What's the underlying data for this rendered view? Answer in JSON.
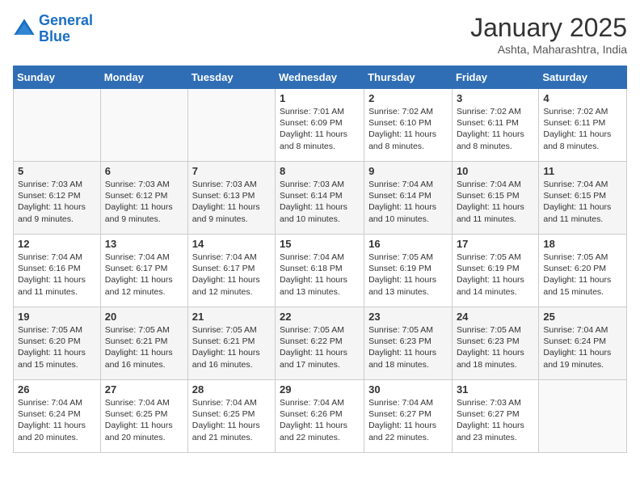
{
  "header": {
    "logo_line1": "General",
    "logo_line2": "Blue",
    "month": "January 2025",
    "location": "Ashta, Maharashtra, India"
  },
  "weekdays": [
    "Sunday",
    "Monday",
    "Tuesday",
    "Wednesday",
    "Thursday",
    "Friday",
    "Saturday"
  ],
  "weeks": [
    [
      {
        "day": "",
        "info": ""
      },
      {
        "day": "",
        "info": ""
      },
      {
        "day": "",
        "info": ""
      },
      {
        "day": "1",
        "info": "Sunrise: 7:01 AM\nSunset: 6:09 PM\nDaylight: 11 hours and 8 minutes."
      },
      {
        "day": "2",
        "info": "Sunrise: 7:02 AM\nSunset: 6:10 PM\nDaylight: 11 hours and 8 minutes."
      },
      {
        "day": "3",
        "info": "Sunrise: 7:02 AM\nSunset: 6:11 PM\nDaylight: 11 hours and 8 minutes."
      },
      {
        "day": "4",
        "info": "Sunrise: 7:02 AM\nSunset: 6:11 PM\nDaylight: 11 hours and 8 minutes."
      }
    ],
    [
      {
        "day": "5",
        "info": "Sunrise: 7:03 AM\nSunset: 6:12 PM\nDaylight: 11 hours and 9 minutes."
      },
      {
        "day": "6",
        "info": "Sunrise: 7:03 AM\nSunset: 6:12 PM\nDaylight: 11 hours and 9 minutes."
      },
      {
        "day": "7",
        "info": "Sunrise: 7:03 AM\nSunset: 6:13 PM\nDaylight: 11 hours and 9 minutes."
      },
      {
        "day": "8",
        "info": "Sunrise: 7:03 AM\nSunset: 6:14 PM\nDaylight: 11 hours and 10 minutes."
      },
      {
        "day": "9",
        "info": "Sunrise: 7:04 AM\nSunset: 6:14 PM\nDaylight: 11 hours and 10 minutes."
      },
      {
        "day": "10",
        "info": "Sunrise: 7:04 AM\nSunset: 6:15 PM\nDaylight: 11 hours and 11 minutes."
      },
      {
        "day": "11",
        "info": "Sunrise: 7:04 AM\nSunset: 6:15 PM\nDaylight: 11 hours and 11 minutes."
      }
    ],
    [
      {
        "day": "12",
        "info": "Sunrise: 7:04 AM\nSunset: 6:16 PM\nDaylight: 11 hours and 11 minutes."
      },
      {
        "day": "13",
        "info": "Sunrise: 7:04 AM\nSunset: 6:17 PM\nDaylight: 11 hours and 12 minutes."
      },
      {
        "day": "14",
        "info": "Sunrise: 7:04 AM\nSunset: 6:17 PM\nDaylight: 11 hours and 12 minutes."
      },
      {
        "day": "15",
        "info": "Sunrise: 7:04 AM\nSunset: 6:18 PM\nDaylight: 11 hours and 13 minutes."
      },
      {
        "day": "16",
        "info": "Sunrise: 7:05 AM\nSunset: 6:19 PM\nDaylight: 11 hours and 13 minutes."
      },
      {
        "day": "17",
        "info": "Sunrise: 7:05 AM\nSunset: 6:19 PM\nDaylight: 11 hours and 14 minutes."
      },
      {
        "day": "18",
        "info": "Sunrise: 7:05 AM\nSunset: 6:20 PM\nDaylight: 11 hours and 15 minutes."
      }
    ],
    [
      {
        "day": "19",
        "info": "Sunrise: 7:05 AM\nSunset: 6:20 PM\nDaylight: 11 hours and 15 minutes."
      },
      {
        "day": "20",
        "info": "Sunrise: 7:05 AM\nSunset: 6:21 PM\nDaylight: 11 hours and 16 minutes."
      },
      {
        "day": "21",
        "info": "Sunrise: 7:05 AM\nSunset: 6:21 PM\nDaylight: 11 hours and 16 minutes."
      },
      {
        "day": "22",
        "info": "Sunrise: 7:05 AM\nSunset: 6:22 PM\nDaylight: 11 hours and 17 minutes."
      },
      {
        "day": "23",
        "info": "Sunrise: 7:05 AM\nSunset: 6:23 PM\nDaylight: 11 hours and 18 minutes."
      },
      {
        "day": "24",
        "info": "Sunrise: 7:05 AM\nSunset: 6:23 PM\nDaylight: 11 hours and 18 minutes."
      },
      {
        "day": "25",
        "info": "Sunrise: 7:04 AM\nSunset: 6:24 PM\nDaylight: 11 hours and 19 minutes."
      }
    ],
    [
      {
        "day": "26",
        "info": "Sunrise: 7:04 AM\nSunset: 6:24 PM\nDaylight: 11 hours and 20 minutes."
      },
      {
        "day": "27",
        "info": "Sunrise: 7:04 AM\nSunset: 6:25 PM\nDaylight: 11 hours and 20 minutes."
      },
      {
        "day": "28",
        "info": "Sunrise: 7:04 AM\nSunset: 6:25 PM\nDaylight: 11 hours and 21 minutes."
      },
      {
        "day": "29",
        "info": "Sunrise: 7:04 AM\nSunset: 6:26 PM\nDaylight: 11 hours and 22 minutes."
      },
      {
        "day": "30",
        "info": "Sunrise: 7:04 AM\nSunset: 6:27 PM\nDaylight: 11 hours and 22 minutes."
      },
      {
        "day": "31",
        "info": "Sunrise: 7:03 AM\nSunset: 6:27 PM\nDaylight: 11 hours and 23 minutes."
      },
      {
        "day": "",
        "info": ""
      }
    ]
  ]
}
